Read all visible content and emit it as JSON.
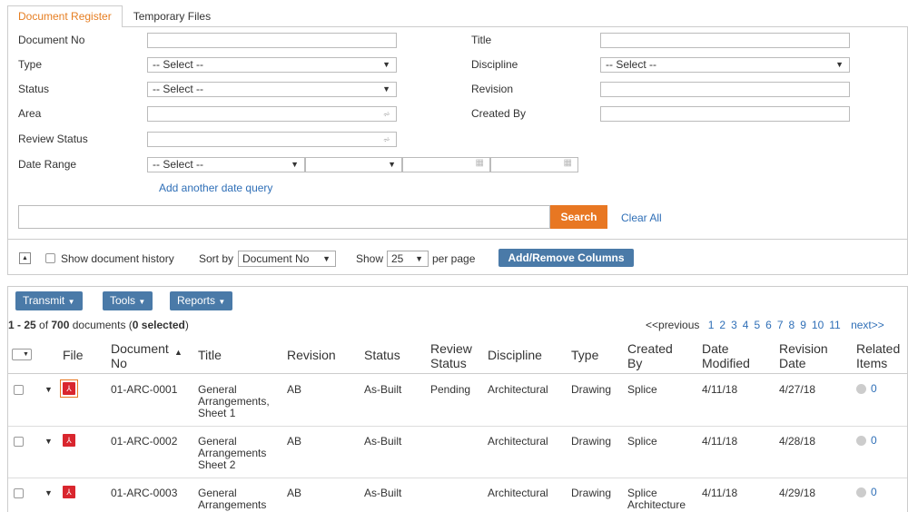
{
  "tabs": [
    {
      "label": "Document Register",
      "active": true
    },
    {
      "label": "Temporary Files",
      "active": false
    }
  ],
  "form": {
    "document_no": {
      "label": "Document No",
      "value": ""
    },
    "title": {
      "label": "Title",
      "value": ""
    },
    "type": {
      "label": "Type",
      "value": "-- Select --"
    },
    "discipline": {
      "label": "Discipline",
      "value": "-- Select --"
    },
    "status": {
      "label": "Status",
      "value": "-- Select --"
    },
    "revision": {
      "label": "Revision",
      "value": ""
    },
    "area": {
      "label": "Area",
      "value": ""
    },
    "created_by": {
      "label": "Created By",
      "value": ""
    },
    "review_status": {
      "label": "Review Status",
      "value": ""
    },
    "date_range": {
      "label": "Date Range",
      "value": "-- Select --"
    },
    "add_date_query": "Add another date query",
    "search_button": "Search",
    "clear_all": "Clear All"
  },
  "options_bar": {
    "show_history": "Show document history",
    "sort_by_label": "Sort by",
    "sort_by_value": "Document No",
    "show_label": "Show",
    "show_value": "25",
    "per_page": "per page",
    "add_remove_columns": "Add/Remove Columns"
  },
  "toolbar": {
    "transmit": "Transmit",
    "tools": "Tools",
    "reports": "Reports"
  },
  "summary": {
    "range": "1 - 25",
    "of": " of ",
    "total": "700",
    "documents": " documents (",
    "selected": "0 selected",
    "close": ")"
  },
  "pagination": {
    "previous": "<<previous",
    "pages": [
      "1",
      "2",
      "3",
      "4",
      "5",
      "6",
      "7",
      "8",
      "9",
      "10",
      "11"
    ],
    "next": "next>>"
  },
  "columns": [
    "File",
    "Document No",
    "Title",
    "Revision",
    "Status",
    "Review Status",
    "Discipline",
    "Type",
    "Created By",
    "Date Modified",
    "Revision Date",
    "Related Items"
  ],
  "rows": [
    {
      "doc_no": "01-ARC-0001",
      "title": "General Arrangements, Sheet 1",
      "revision": "AB",
      "status": "As-Built",
      "review_status": "Pending",
      "discipline": "Architectural",
      "type": "Drawing",
      "created_by": "Splice",
      "date_modified": "4/11/18",
      "revision_date": "4/27/18",
      "related": "0"
    },
    {
      "doc_no": "01-ARC-0002",
      "title": "General Arrangements Sheet 2",
      "revision": "AB",
      "status": "As-Built",
      "review_status": "",
      "discipline": "Architectural",
      "type": "Drawing",
      "created_by": "Splice",
      "date_modified": "4/11/18",
      "revision_date": "4/28/18",
      "related": "0"
    },
    {
      "doc_no": "01-ARC-0003",
      "title": "General Arrangements",
      "revision": "AB",
      "status": "As-Built",
      "review_status": "",
      "discipline": "Architectural",
      "type": "Drawing",
      "created_by": "Splice Architecture",
      "date_modified": "4/11/18",
      "revision_date": "4/29/18",
      "related": "0"
    }
  ],
  "colors": {
    "accent": "#e87722",
    "link": "#2f6fb7",
    "toolbar": "#4a7aa8",
    "pdf": "#d9262e"
  }
}
